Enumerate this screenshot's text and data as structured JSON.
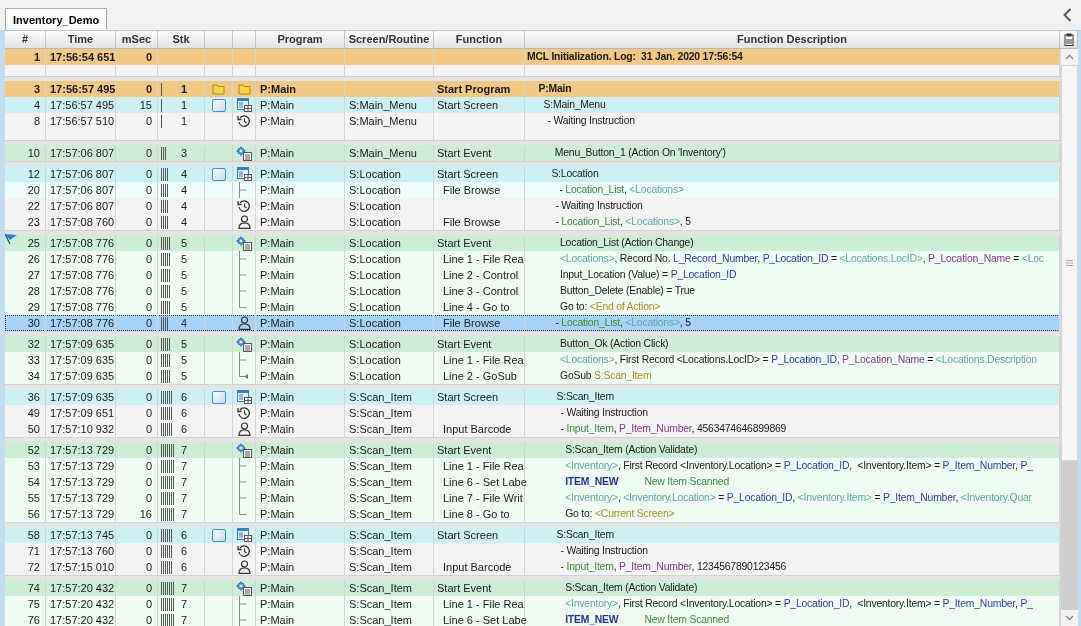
{
  "tab": {
    "label": "Inventory_Demo",
    "selected": true
  },
  "columns": [
    "#",
    "Time",
    "mSec",
    "Stk",
    "Program",
    "Screen/Routine",
    "Function",
    "Function Description"
  ],
  "groups": [
    {
      "rows": [
        {
          "kind": "init",
          "no": "1",
          "time": "17:56:54 651",
          "msec": "0",
          "description": [
            {
              "kind": "plain",
              "text": "MCL Initialization. Log:  31 Jan. 2020 17:56:54"
            }
          ],
          "selected": false,
          "flagged": false
        },
        {
          "kind": "blank",
          "selected": false,
          "flagged": false
        }
      ]
    },
    {
      "rows": [
        {
          "kind": "program",
          "no": "3",
          "time": "17:56:57 495",
          "msec": "0",
          "stk": "1",
          "program": "P:Main",
          "function": "Start Program",
          "description": [
            {
              "kind": "plain",
              "text": "P:Main"
            }
          ],
          "selected": false,
          "flagged": false
        },
        {
          "kind": "screen",
          "no": "4",
          "time": "17:56:57 495",
          "msec": "15",
          "stk": "1",
          "program": "P:Main",
          "screen": "S:Main_Menu",
          "function": "Start Screen",
          "description": [
            {
              "kind": "plain",
              "text": "S:Main_Menu"
            }
          ],
          "selected": false,
          "flagged": false
        },
        {
          "kind": "wait",
          "no": "8",
          "time": "17:56:57 510",
          "msec": "0",
          "stk": "1",
          "program": "P:Main",
          "screen": "S:Main_Menu",
          "description": [
            {
              "kind": "plain",
              "text": "- Waiting Instruction"
            }
          ],
          "selected": false,
          "flagged": false
        },
        {
          "kind": "blank",
          "selected": false,
          "flagged": false
        }
      ]
    },
    {
      "rows": [
        {
          "kind": "event",
          "no": "10",
          "time": "17:57:06 807",
          "msec": "0",
          "stk": "3",
          "program": "P:Main",
          "screen": "S:Main_Menu",
          "function": "Start Event",
          "description": [
            {
              "kind": "plain",
              "text": "Menu_Button_1 (Action On 'Inventory')"
            }
          ],
          "selected": false,
          "flagged": false
        }
      ]
    },
    {
      "rows": [
        {
          "kind": "screen",
          "no": "12",
          "time": "17:57:06 807",
          "msec": "0",
          "stk": "4",
          "program": "P:Main",
          "screen": "S:Location",
          "function": "Start Screen",
          "description": [
            {
              "kind": "plain",
              "text": "S:Location"
            }
          ],
          "selected": false,
          "flagged": false
        },
        {
          "kind": "browse_line",
          "no": "20",
          "time": "17:57:06 807",
          "msec": "0",
          "stk": "4",
          "program": "P:Main",
          "screen": "S:Location",
          "function": "File Browse",
          "description": [
            {
              "kind": "plain",
              "text": "- "
            },
            {
              "kind": "control",
              "text": "Location_List"
            },
            {
              "kind": "plain",
              "text": ", "
            },
            {
              "kind": "table",
              "text": "<Locations>"
            }
          ],
          "selected": false,
          "flagged": false
        },
        {
          "kind": "wait",
          "no": "22",
          "time": "17:57:06 807",
          "msec": "0",
          "stk": "4",
          "program": "P:Main",
          "screen": "S:Location",
          "description": [
            {
              "kind": "plain",
              "text": "- Waiting Instruction"
            }
          ],
          "selected": false,
          "flagged": false
        },
        {
          "kind": "browse",
          "no": "23",
          "time": "17:57:08 760",
          "msec": "0",
          "stk": "4",
          "program": "P:Main",
          "screen": "S:Location",
          "function": "File Browse",
          "description": [
            {
              "kind": "plain",
              "text": "- "
            },
            {
              "kind": "control",
              "text": "Location_List"
            },
            {
              "kind": "plain",
              "text": ", "
            },
            {
              "kind": "table",
              "text": "<Locations>"
            },
            {
              "kind": "plain",
              "text": ", 5"
            }
          ],
          "selected": false,
          "flagged": false
        }
      ]
    },
    {
      "rows": [
        {
          "kind": "event",
          "no": "25",
          "time": "17:57:08 776",
          "msec": "0",
          "stk": "5",
          "program": "P:Main",
          "screen": "S:Location",
          "function": "Start Event",
          "description": [
            {
              "kind": "plain",
              "text": "Location_List (Action Change)"
            }
          ],
          "selected": false,
          "flagged": true
        },
        {
          "kind": "step",
          "no": "26",
          "time": "17:57:08 776",
          "msec": "0",
          "stk": "5",
          "program": "P:Main",
          "screen": "S:Location",
          "function": "Line 1 - File Rea",
          "description": [
            {
              "kind": "table",
              "text": "<Locations>"
            },
            {
              "kind": "plain",
              "text": ", Record No. "
            },
            {
              "kind": "var",
              "text": "L_Record_Number"
            },
            {
              "kind": "plain",
              "text": ", "
            },
            {
              "kind": "var",
              "text": "P_Location_ID"
            },
            {
              "kind": "plain",
              "text": " = "
            },
            {
              "kind": "table",
              "text": "<Locations.LocID>"
            },
            {
              "kind": "plain",
              "text": ", "
            },
            {
              "kind": "param",
              "text": "P_Location_Name"
            },
            {
              "kind": "plain",
              "text": " = "
            },
            {
              "kind": "table",
              "text": "<Loc"
            }
          ],
          "selected": false,
          "flagged": false
        },
        {
          "kind": "step",
          "no": "27",
          "time": "17:57:08 776",
          "msec": "0",
          "stk": "5",
          "program": "P:Main",
          "screen": "S:Location",
          "function": "Line 2 - Control",
          "description": [
            {
              "kind": "plain",
              "text": "Input_Location (Value) = "
            },
            {
              "kind": "var",
              "text": "P_Location_ID"
            }
          ],
          "selected": false,
          "flagged": false
        },
        {
          "kind": "step",
          "no": "28",
          "time": "17:57:08 776",
          "msec": "0",
          "stk": "5",
          "program": "P:Main",
          "screen": "S:Location",
          "function": "Line 3 - Control",
          "description": [
            {
              "kind": "plain",
              "text": "Button_Delete (Enable) = True"
            }
          ],
          "selected": false,
          "flagged": false
        },
        {
          "kind": "step_end",
          "no": "29",
          "time": "17:57:08 776",
          "msec": "0",
          "stk": "5",
          "program": "P:Main",
          "screen": "S:Location",
          "function": "Line 4 - Go to",
          "description": [
            {
              "kind": "plain",
              "text": "Go to: "
            },
            {
              "kind": "link",
              "text": "<End of Action>"
            }
          ],
          "selected": false,
          "flagged": false
        },
        {
          "kind": "browse",
          "no": "30",
          "time": "17:57:08 776",
          "msec": "0",
          "stk": "4",
          "program": "P:Main",
          "screen": "S:Location",
          "function": "File Browse",
          "description": [
            {
              "kind": "plain",
              "text": "- "
            },
            {
              "kind": "control",
              "text": "Location_List"
            },
            {
              "kind": "plain",
              "text": ", "
            },
            {
              "kind": "table",
              "text": "<Locations>"
            },
            {
              "kind": "plain",
              "text": ", 5"
            }
          ],
          "selected": true,
          "flagged": false
        }
      ]
    },
    {
      "rows": [
        {
          "kind": "event",
          "no": "32",
          "time": "17:57:09 635",
          "msec": "0",
          "stk": "5",
          "program": "P:Main",
          "screen": "S:Location",
          "function": "Start Event",
          "description": [
            {
              "kind": "plain",
              "text": "Button_Ok (Action Click)"
            }
          ],
          "selected": false,
          "flagged": false
        },
        {
          "kind": "step",
          "no": "33",
          "time": "17:57:09 635",
          "msec": "0",
          "stk": "5",
          "program": "P:Main",
          "screen": "S:Location",
          "function": "Line 1 - File Rea",
          "description": [
            {
              "kind": "table",
              "text": "<Locations>"
            },
            {
              "kind": "plain",
              "text": ", First Record <Locations.LocID> = "
            },
            {
              "kind": "var",
              "text": "P_Location_ID"
            },
            {
              "kind": "plain",
              "text": ", "
            },
            {
              "kind": "param",
              "text": "P_Location_Name"
            },
            {
              "kind": "plain",
              "text": " = "
            },
            {
              "kind": "table",
              "text": "<Locations.Description"
            }
          ],
          "selected": false,
          "flagged": false
        },
        {
          "kind": "step_return",
          "no": "34",
          "time": "17:57:09 635",
          "msec": "0",
          "stk": "5",
          "program": "P:Main",
          "screen": "S:Location",
          "function": "Line 2 - GoSub",
          "description": [
            {
              "kind": "plain",
              "text": "GoSub "
            },
            {
              "kind": "link",
              "text": "S:Scan_Item"
            }
          ],
          "selected": false,
          "flagged": false
        }
      ]
    },
    {
      "rows": [
        {
          "kind": "screen",
          "no": "36",
          "time": "17:57:09 635",
          "msec": "0",
          "stk": "6",
          "program": "P:Main",
          "screen": "S:Scan_Item",
          "function": "Start Screen",
          "description": [
            {
              "kind": "plain",
              "text": "S:Scan_Item"
            }
          ],
          "selected": false,
          "flagged": false
        },
        {
          "kind": "wait",
          "no": "49",
          "time": "17:57:09 651",
          "msec": "0",
          "stk": "6",
          "program": "P:Main",
          "screen": "S:Scan_Item",
          "description": [
            {
              "kind": "plain",
              "text": "- Waiting Instruction"
            }
          ],
          "selected": false,
          "flagged": false
        },
        {
          "kind": "browse",
          "no": "50",
          "time": "17:57:10 932",
          "msec": "0",
          "stk": "6",
          "program": "P:Main",
          "screen": "S:Scan_Item",
          "function": "Input Barcode",
          "description": [
            {
              "kind": "plain",
              "text": "- "
            },
            {
              "kind": "control",
              "text": "Input_Item"
            },
            {
              "kind": "plain",
              "text": ", "
            },
            {
              "kind": "param",
              "text": "P_Item_Number"
            },
            {
              "kind": "plain",
              "text": ", 4563474646899869"
            }
          ],
          "selected": false,
          "flagged": false
        }
      ]
    },
    {
      "rows": [
        {
          "kind": "event",
          "no": "52",
          "time": "17:57:13 729",
          "msec": "0",
          "stk": "7",
          "program": "P:Main",
          "screen": "S:Scan_Item",
          "function": "Start Event",
          "description": [
            {
              "kind": "plain",
              "text": "S:Scan_Item (Action Validate)"
            }
          ],
          "selected": false,
          "flagged": false
        },
        {
          "kind": "step",
          "no": "53",
          "time": "17:57:13 729",
          "msec": "0",
          "stk": "7",
          "program": "P:Main",
          "screen": "S:Scan_Item",
          "function": "Line 1 - File Rea",
          "description": [
            {
              "kind": "table",
              "text": "<Inventory>"
            },
            {
              "kind": "plain",
              "text": ", First Record <Inventory.Location> = "
            },
            {
              "kind": "var",
              "text": "P_Location_ID"
            },
            {
              "kind": "plain",
              "text": ",  <Inventory.Item> = "
            },
            {
              "kind": "var",
              "text": "P_Item_Number"
            },
            {
              "kind": "plain",
              "text": ", "
            },
            {
              "kind": "var",
              "text": "P_"
            }
          ],
          "selected": false,
          "flagged": false
        },
        {
          "kind": "step",
          "no": "54",
          "time": "17:57:13 729",
          "msec": "0",
          "stk": "7",
          "program": "P:Main",
          "screen": "S:Scan_Item",
          "function": "Line 6 - Set Labe",
          "description": [
            {
              "kind": "const",
              "text": "ITEM_NEW"
            },
            {
              "kind": "control",
              "text": "New Item Scanned"
            }
          ],
          "selected": false,
          "flagged": false
        },
        {
          "kind": "step",
          "no": "55",
          "time": "17:57:13 729",
          "msec": "0",
          "stk": "7",
          "program": "P:Main",
          "screen": "S:Scan_Item",
          "function": "Line 7 - File Writ",
          "description": [
            {
              "kind": "table",
              "text": "<Inventory>"
            },
            {
              "kind": "plain",
              "text": ", "
            },
            {
              "kind": "table",
              "text": "<Inventory.Location>"
            },
            {
              "kind": "plain",
              "text": " = "
            },
            {
              "kind": "var",
              "text": "P_Location_ID"
            },
            {
              "kind": "plain",
              "text": ", "
            },
            {
              "kind": "table",
              "text": "<Inventory.Item>"
            },
            {
              "kind": "plain",
              "text": " = "
            },
            {
              "kind": "var",
              "text": "P_Item_Number"
            },
            {
              "kind": "plain",
              "text": ", "
            },
            {
              "kind": "table",
              "text": "<Inventory.Quar"
            }
          ],
          "selected": false,
          "flagged": false
        },
        {
          "kind": "step_end",
          "no": "56",
          "time": "17:57:13 729",
          "msec": "16",
          "stk": "7",
          "program": "P:Main",
          "screen": "S:Scan_Item",
          "function": "Line 8 - Go to",
          "description": [
            {
              "kind": "plain",
              "text": "Go to: "
            },
            {
              "kind": "link",
              "text": "<Current Screen>"
            }
          ],
          "selected": false,
          "flagged": false
        }
      ]
    },
    {
      "rows": [
        {
          "kind": "screen",
          "no": "58",
          "time": "17:57:13 745",
          "msec": "0",
          "stk": "6",
          "program": "P:Main",
          "screen": "S:Scan_Item",
          "function": "Start Screen",
          "description": [
            {
              "kind": "plain",
              "text": "S:Scan_Item"
            }
          ],
          "selected": false,
          "flagged": false
        },
        {
          "kind": "wait",
          "no": "71",
          "time": "17:57:13 760",
          "msec": "0",
          "stk": "6",
          "program": "P:Main",
          "screen": "S:Scan_Item",
          "description": [
            {
              "kind": "plain",
              "text": "- Waiting Instruction"
            }
          ],
          "selected": false,
          "flagged": false
        },
        {
          "kind": "browse",
          "no": "72",
          "time": "17:57:15 010",
          "msec": "0",
          "stk": "6",
          "program": "P:Main",
          "screen": "S:Scan_Item",
          "function": "Input Barcode",
          "description": [
            {
              "kind": "plain",
              "text": "- "
            },
            {
              "kind": "control",
              "text": "Input_Item"
            },
            {
              "kind": "plain",
              "text": ", "
            },
            {
              "kind": "param",
              "text": "P_Item_Number"
            },
            {
              "kind": "plain",
              "text": ", 1234567890123456"
            }
          ],
          "selected": false,
          "flagged": false
        }
      ]
    },
    {
      "rows": [
        {
          "kind": "event",
          "no": "74",
          "time": "17:57:20 432",
          "msec": "0",
          "stk": "7",
          "program": "P:Main",
          "screen": "S:Scan_Item",
          "function": "Start Event",
          "description": [
            {
              "kind": "plain",
              "text": "S:Scan_Item (Action Validate)"
            }
          ],
          "selected": false,
          "flagged": false
        },
        {
          "kind": "step",
          "no": "75",
          "time": "17:57:20 432",
          "msec": "0",
          "stk": "7",
          "program": "P:Main",
          "screen": "S:Scan_Item",
          "function": "Line 1 - File Rea",
          "description": [
            {
              "kind": "table",
              "text": "<Inventory>"
            },
            {
              "kind": "plain",
              "text": ", First Record <Inventory.Location> = "
            },
            {
              "kind": "var",
              "text": "P_Location_ID"
            },
            {
              "kind": "plain",
              "text": ",  <Inventory.Item> = "
            },
            {
              "kind": "var",
              "text": "P_Item_Number"
            },
            {
              "kind": "plain",
              "text": ", "
            },
            {
              "kind": "var",
              "text": "P_"
            }
          ],
          "selected": false,
          "flagged": false
        },
        {
          "kind": "step",
          "no": "76",
          "time": "17:57:20 432",
          "msec": "0",
          "stk": "7",
          "program": "P:Main",
          "screen": "S:Scan_Item",
          "function": "Line 6 - Set Labe",
          "description": [
            {
              "kind": "const",
              "text": "ITEM_NEW"
            },
            {
              "kind": "control",
              "text": "New Item Scanned"
            }
          ],
          "selected": false,
          "flagged": false
        }
      ]
    }
  ]
}
